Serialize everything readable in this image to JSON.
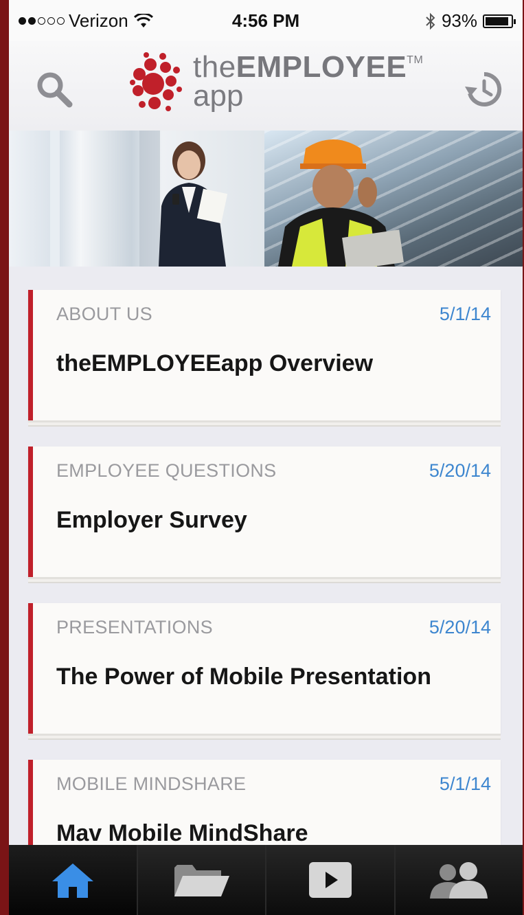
{
  "status_bar": {
    "signal_filled": 2,
    "signal_total": 5,
    "carrier": "Verizon",
    "time": "4:56 PM",
    "battery_percent": "93%",
    "battery_level": 0.93
  },
  "header": {
    "logo_line1_prefix": "the",
    "logo_line1_bold": "EMPLOYEE",
    "logo_tm": "TM",
    "logo_line2": "app",
    "brand_color": "#c0202a"
  },
  "feed": {
    "items": [
      {
        "category": "ABOUT US",
        "date": "5/1/14",
        "title": "theEMPLOYEEapp Overview"
      },
      {
        "category": "EMPLOYEE QUESTIONS",
        "date": "5/20/14",
        "title": "Employer Survey"
      },
      {
        "category": "PRESENTATIONS",
        "date": "5/20/14",
        "title": "The Power of Mobile Presentation"
      },
      {
        "category": "MOBILE MINDSHARE",
        "date": "5/1/14",
        "title": "Mav Mobile MindShare"
      }
    ]
  },
  "tabbar": {
    "tabs": [
      {
        "icon": "home-icon",
        "active": true
      },
      {
        "icon": "folder-icon",
        "active": false
      },
      {
        "icon": "play-icon",
        "active": false
      },
      {
        "icon": "people-icon",
        "active": false
      }
    ],
    "active_color": "#3a8ee6"
  },
  "colors": {
    "accent_date": "#3d86cf",
    "card_border": "#c0202a"
  }
}
